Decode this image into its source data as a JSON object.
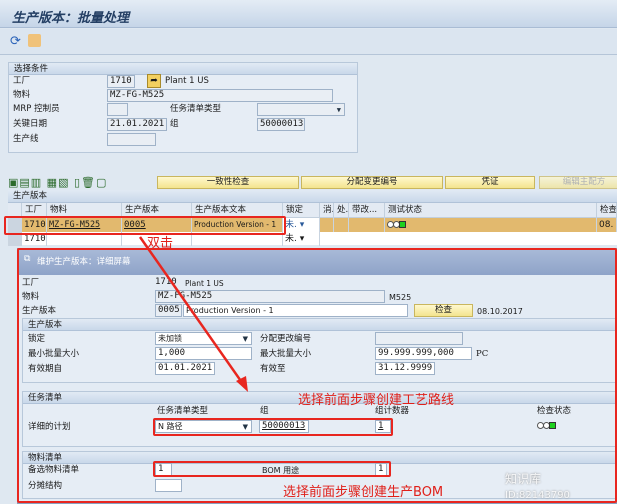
{
  "window": {
    "title": "生产版本：批量处理"
  },
  "toolbar": {
    "icons": [
      "refresh-icon",
      "scroll-icon"
    ]
  },
  "selection": {
    "header": "选择条件",
    "plant_label": "工厂",
    "plant": "1710",
    "plant_name": "Plant 1 US",
    "material_label": "物料",
    "material": "MZ-FG-M525",
    "mrp_label": "MRP 控制员",
    "mrp": "",
    "tasklist_type_label": "任务清单类型",
    "tasklist_type": "",
    "keydate_label": "关键日期",
    "keydate": "21.01.2021",
    "group_label": "组",
    "group": "50000013",
    "line_label": "生产线",
    "line": ""
  },
  "table_toolbar": {
    "buttons": [
      "一致性检查",
      "分配变更编号",
      "凭证",
      "编辑主配方"
    ]
  },
  "table": {
    "title": "生产版本",
    "columns": [
      "工厂",
      "物料",
      "生产版本",
      "生产版本文本",
      "锁定",
      "消.",
      "处.",
      "带改...",
      "测试状态",
      "检查"
    ],
    "rows": [
      {
        "plant": "1710",
        "material": "MZ-FG-M525",
        "version": "0005",
        "text": "Production Version - 1",
        "lock": "未.",
        "test_status": "green",
        "check": "08."
      },
      {
        "plant": "1710",
        "material": "",
        "version": "",
        "text": "",
        "lock": "未.",
        "test_status": "",
        "check": ""
      }
    ]
  },
  "dialog": {
    "title": "维护生产版本：详细屏幕",
    "plant_label": "工厂",
    "plant": "1710",
    "plant_name": "Plant 1 US",
    "material_label": "物料",
    "material": "MZ-FG-M525",
    "material_short": "M525",
    "version_label": "生产版本",
    "version": "0005",
    "version_text": "Production Version - 1",
    "check_button": "检查",
    "check_date": "08.10.2017",
    "pv_group": {
      "header": "生产版本",
      "lock_label": "锁定",
      "lock": "未加锁",
      "change_no_label": "分配更改编号",
      "change_no": "",
      "min_label": "最小批量大小",
      "min": "1,000",
      "max_label": "最大批量大小",
      "max": "99.999.999,000",
      "unit": "PC",
      "valid_from_label": "有效期自",
      "valid_from": "01.01.2021",
      "valid_to_label": "有效至",
      "valid_to": "31.12.9999"
    },
    "tasklist": {
      "header": "任务清单",
      "type_col": "任务清单类型",
      "group_col": "组",
      "counter_col": "组计数器",
      "status_col": "检查状态",
      "row_label": "详细的计划",
      "type": "N 路径",
      "group": "50000013",
      "counter": "1"
    },
    "bom": {
      "header": "物料清单",
      "alt_label": "备选物料清单",
      "alt": "1",
      "usage_label": "BOM 用途",
      "usage": "1",
      "apportion_label": "分摊结构",
      "apportion": ""
    }
  },
  "annotations": {
    "double_click": "双击",
    "routing_note": "选择前面步骤创建工艺路线",
    "bom_note": "选择前面步骤创建生产BOM",
    "accent": "#e8261f"
  },
  "watermark": {
    "text": "知识库",
    "id": "ID:82143790"
  }
}
